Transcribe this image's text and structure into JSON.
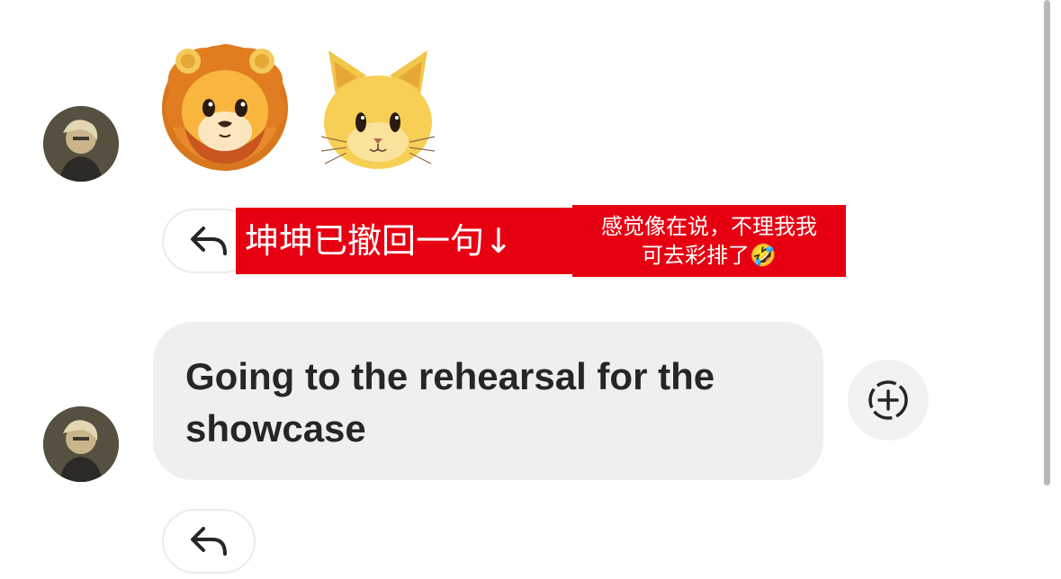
{
  "thread": {
    "messages": [
      {
        "type": "emoji",
        "emojis": [
          "lion-face",
          "cat-face"
        ]
      },
      {
        "type": "text",
        "text_line1": "Going to the rehearsal for the",
        "text_line2": "showcase"
      }
    ]
  },
  "overlay": {
    "caption": "坤坤已撤回一句↓",
    "note_line1": "感觉像在说，不理我我",
    "note_line2": "可去彩排了🤣"
  },
  "icons": {
    "reply": "reply-arrow-icon",
    "react": "add-reaction-icon",
    "lion": "lion-emoji-icon",
    "cat": "cat-emoji-icon"
  },
  "colors": {
    "overlay_red": "#e60012",
    "bubble_gray": "#efefef",
    "text_dark": "#262626"
  }
}
